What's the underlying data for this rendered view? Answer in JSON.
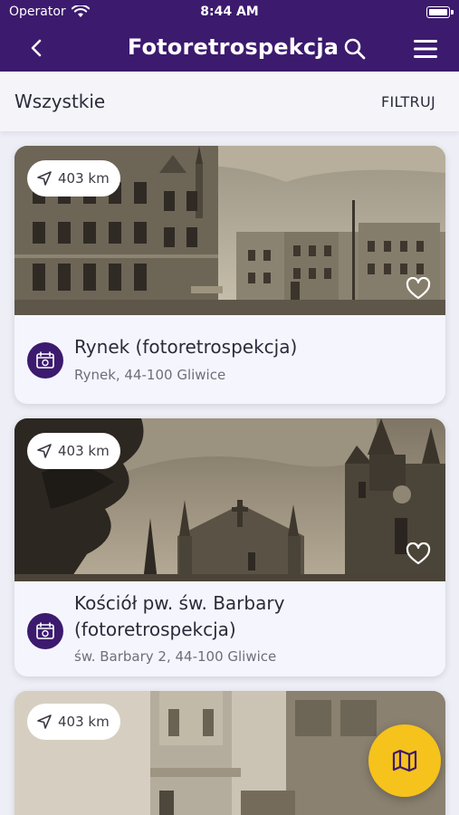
{
  "status": {
    "carrier": "Operator",
    "time": "8:44 AM"
  },
  "nav": {
    "title": "Fotoretrospekcja"
  },
  "filterbar": {
    "heading": "Wszystkie",
    "filter_label": "FILTRUJ"
  },
  "cards": [
    {
      "distance": "403 km",
      "title": "Rynek (fotoretrospekcja)",
      "address": "Rynek, 44-100 Gliwice"
    },
    {
      "distance": "403 km",
      "title": "Kościół pw. św. Barbary (fotoretrospekcja)",
      "address": "św. Barbary 2, 44-100 Gliwice"
    },
    {
      "distance": "403 km"
    }
  ],
  "icons": {
    "back": "chevron-left-icon",
    "search": "search-icon",
    "menu": "hamburger-menu-icon",
    "distance": "location-arrow-icon",
    "favorite": "heart-outline-icon",
    "category": "calendar-photo-icon",
    "map": "map-icon"
  },
  "colors": {
    "header": "#3c1a6e",
    "fab": "#f6c21c",
    "card": "#f5f6fd"
  }
}
